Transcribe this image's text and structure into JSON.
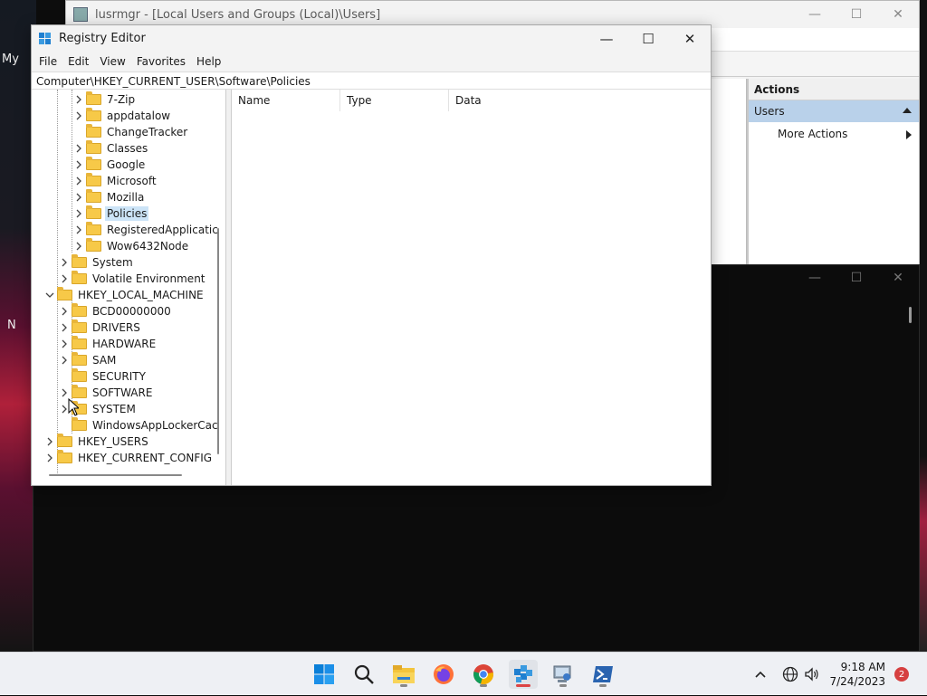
{
  "desktop": {
    "icon_label_1": "My",
    "icon_label_2": "N"
  },
  "lusrmgr": {
    "title": "lusrmgr - [Local Users and Groups (Local)\\Users]",
    "actions": {
      "header": "Actions",
      "section": "Users",
      "more_actions": "More Actions"
    }
  },
  "registry_editor": {
    "title": "Registry Editor",
    "menu": [
      "File",
      "Edit",
      "View",
      "Favorites",
      "Help"
    ],
    "address": "Computer\\HKEY_CURRENT_USER\\Software\\Policies",
    "tree": [
      {
        "label": "7-Zip",
        "level": 3,
        "expander": true
      },
      {
        "label": "appdatalow",
        "level": 3,
        "expander": true
      },
      {
        "label": "ChangeTracker",
        "level": 3,
        "expander": false
      },
      {
        "label": "Classes",
        "level": 3,
        "expander": true
      },
      {
        "label": "Google",
        "level": 3,
        "expander": true
      },
      {
        "label": "Microsoft",
        "level": 3,
        "expander": true
      },
      {
        "label": "Mozilla",
        "level": 3,
        "expander": true
      },
      {
        "label": "Policies",
        "level": 3,
        "expander": true,
        "selected": true
      },
      {
        "label": "RegisteredApplicatic",
        "level": 3,
        "expander": true
      },
      {
        "label": "Wow6432Node",
        "level": 3,
        "expander": true
      },
      {
        "label": "System",
        "level": 2,
        "expander": true
      },
      {
        "label": "Volatile Environment",
        "level": 2,
        "expander": true
      },
      {
        "label": "HKEY_LOCAL_MACHINE",
        "level": 1,
        "expander": true,
        "expanded": true
      },
      {
        "label": "BCD00000000",
        "level": 2,
        "expander": true
      },
      {
        "label": "DRIVERS",
        "level": 2,
        "expander": true
      },
      {
        "label": "HARDWARE",
        "level": 2,
        "expander": true
      },
      {
        "label": "SAM",
        "level": 2,
        "expander": true
      },
      {
        "label": "SECURITY",
        "level": 2,
        "expander": false
      },
      {
        "label": "SOFTWARE",
        "level": 2,
        "expander": true
      },
      {
        "label": "SYSTEM",
        "level": 2,
        "expander": true
      },
      {
        "label": "WindowsAppLockerCac",
        "level": 2,
        "expander": false
      },
      {
        "label": "HKEY_USERS",
        "level": 1,
        "expander": true
      },
      {
        "label": "HKEY_CURRENT_CONFIG",
        "level": 1,
        "expander": true
      }
    ],
    "columns": [
      "Name",
      "Type",
      "Data"
    ]
  },
  "taskbar": {
    "apps": [
      "start-icon",
      "search-icon",
      "file-explorer-icon",
      "firefox-icon",
      "chrome-icon",
      "registry-editor-icon",
      "lusrmgr-icon",
      "powershell-icon"
    ],
    "time": "9:18 AM",
    "date": "7/24/2023",
    "notification_count": "2"
  },
  "colors": {
    "selection": "#cce4f7",
    "folder": "#f7c948",
    "actions_highlight": "#b9d1ea",
    "notification": "#d64040"
  }
}
